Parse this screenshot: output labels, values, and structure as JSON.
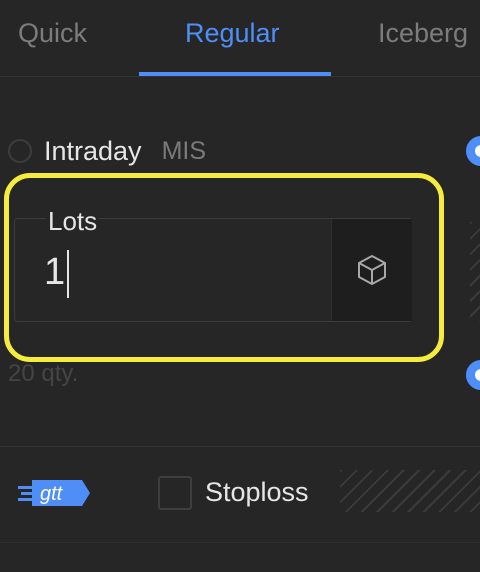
{
  "tabs": {
    "quick": "Quick",
    "regular": "Regular",
    "iceberg": "Iceberg",
    "active": "Regular"
  },
  "product": {
    "label": "Intraday",
    "code": "MIS"
  },
  "lots": {
    "label": "Lots",
    "value": "1",
    "icon": "cube-icon"
  },
  "qty_hint": "20 qty.",
  "gtt": {
    "label": "gtt",
    "icon": "gtt-icon"
  },
  "stoploss": {
    "label": "Stoploss",
    "checked": false
  },
  "colors": {
    "accent": "#4f8ef7",
    "highlight": "#f5ec3d",
    "background": "#262626"
  }
}
